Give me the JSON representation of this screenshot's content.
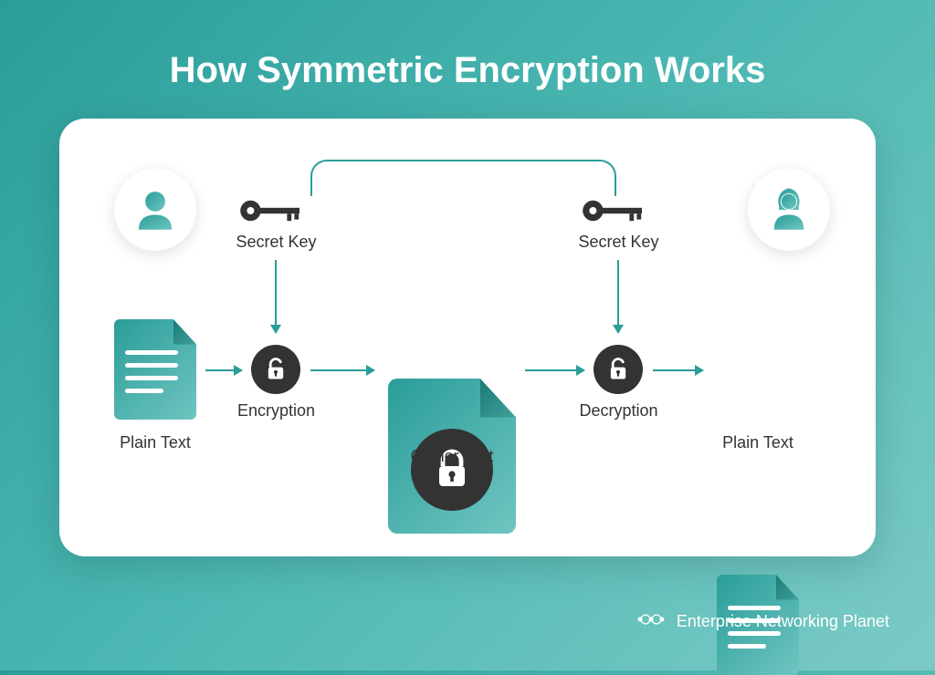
{
  "title": "How Symmetric Encryption Works",
  "nodes": {
    "sender_plain": "Plain Text",
    "secret_key_left": "Secret Key",
    "encryption": "Encryption",
    "cipher_text": "Cipher Text",
    "secret_key_right": "Secret Key",
    "decryption": "Decryption",
    "receiver_plain": "Plain Text"
  },
  "footer": "Enterprise Networking Planet",
  "colors": {
    "teal": "#2a9d99",
    "dark": "#333333"
  }
}
